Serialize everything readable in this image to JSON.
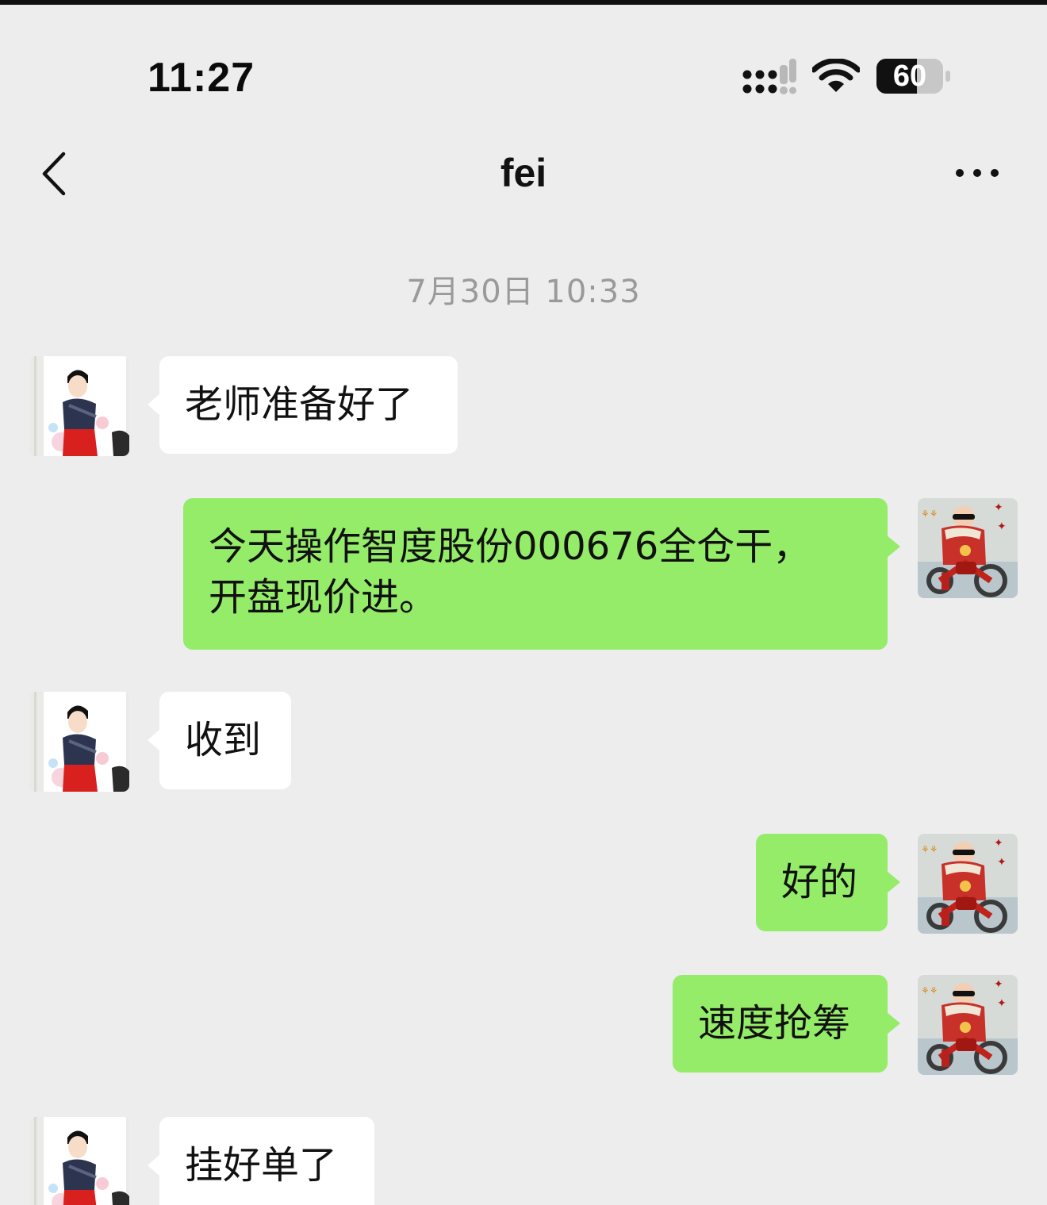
{
  "status_bar": {
    "time": "11:27",
    "battery_level": "60",
    "signal_icon": "cellular-signal-icon",
    "wifi_icon": "wifi-icon",
    "battery_icon": "battery-icon"
  },
  "nav": {
    "title": "fei",
    "back_icon": "chevron-left-icon",
    "more_icon": "more-dots-icon"
  },
  "chat": {
    "timestamp": "7月30日 10:33",
    "messages": [
      {
        "side": "in",
        "text": "老师准备好了"
      },
      {
        "side": "out",
        "text": "今天操作智度股份000676全仓干，开盘现价进。"
      },
      {
        "side": "in",
        "text": "收到"
      },
      {
        "side": "out",
        "text": "好的"
      },
      {
        "side": "out",
        "text": "速度抢筹"
      },
      {
        "side": "in",
        "text": "挂好单了"
      }
    ]
  },
  "colors": {
    "background": "#ededed",
    "incoming_bubble": "#ffffff",
    "outgoing_bubble": "#95ec69",
    "timestamp_text": "#9a9a9a"
  }
}
